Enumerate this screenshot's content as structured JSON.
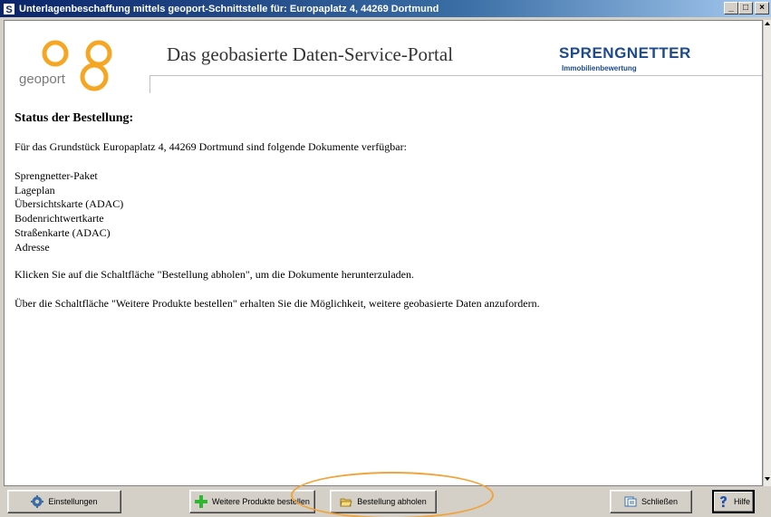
{
  "window": {
    "app_icon": "S",
    "title": "Unterlagenbeschaffung mittels geoport-Schnittstelle für: Europaplatz 4, 44269 Dortmund",
    "minimize_label": "_",
    "maximize_label": "□",
    "close_label": "×"
  },
  "header": {
    "logo_text": "geoport",
    "portal_title": "Das geobasierte Daten-Service-Portal",
    "brand_name": "SPRENGNETTER",
    "brand_sub": "Immobilienbewertung"
  },
  "main": {
    "heading": "Status der Bestellung:",
    "intro": "Für das Grundstück Europaplatz 4, 44269 Dortmund sind folgende Dokumente verfügbar:",
    "documents": [
      "Sprengnetter-Paket",
      "Lageplan",
      "Übersichtskarte (ADAC)",
      "Bodenrichtwertkarte",
      "Straßenkarte (ADAC)",
      "Adresse"
    ],
    "hint_download": "Klicken Sie auf die Schaltfläche \"Bestellung abholen\", um die Dokumente herunterzuladen.",
    "hint_more": "Über die Schaltfläche \"Weitere Produkte bestellen\" erhalten Sie die Möglichkeit, weitere geobasierte Daten anzufordern."
  },
  "toolbar": {
    "settings_label": "Einstellungen",
    "more_products_label": "Weitere Produkte bestellen",
    "fetch_order_label": "Bestellung abholen",
    "close_label": "Schließen",
    "help_label": "Hilfe"
  },
  "colors": {
    "title_bar": "#0a246a",
    "brand_blue": "#1c4a8a",
    "geoport_orange": "#f5a623",
    "highlight_orange": "#f0a43c",
    "plus_green": "#2fb52f"
  },
  "icons": {
    "settings": "gear-icon",
    "more_products": "plus-icon",
    "fetch_order": "folder-open-icon",
    "close": "close-window-icon",
    "help": "help-icon"
  }
}
